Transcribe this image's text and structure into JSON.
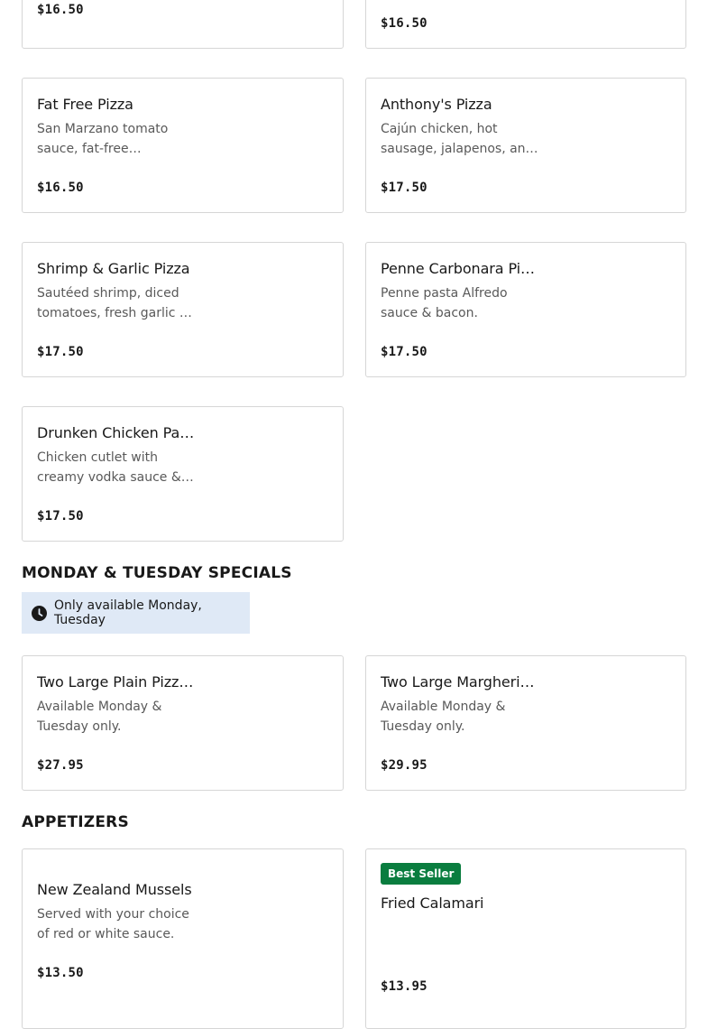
{
  "cards": {
    "top_left": {
      "price": "$16.50"
    },
    "top_right": {
      "price": "$16.50"
    },
    "fat_free": {
      "title": "Fat Free Pizza",
      "desc": "San Marzano tomato sauce, fat-free mozzarella cheese.",
      "price": "$16.50"
    },
    "anthonys": {
      "title": "Anthony's Pizza",
      "desc": "Cajún chicken, hot sausage, jalapenos, and peppers.",
      "price": "$17.50"
    },
    "shrimp_garlic": {
      "title": "Shrimp & Garlic Pizza",
      "desc": "Sautéed shrimp, diced tomatoes, fresh garlic w/ olive oil.",
      "price": "$17.50"
    },
    "penne_carbonara": {
      "title": "Penne Carbonara Pizza",
      "desc": "Penne pasta Alfredo sauce & bacon.",
      "price": "$17.50"
    },
    "drunken_chicken": {
      "title": "Drunken Chicken Parm Pizza",
      "desc": "Chicken cutlet with creamy vodka sauce & mozzarella cheese.",
      "price": "$17.50"
    }
  },
  "specials": {
    "heading": "MONDAY & TUESDAY SPECIALS",
    "availability": "Only available Monday, Tuesday",
    "two_plain": {
      "title": "Two Large Plain Pizzas",
      "desc": "Available Monday & Tuesday only.",
      "price": "$27.95"
    },
    "two_margherita": {
      "title": "Two Large Margherita Pizzas",
      "desc": "Available Monday & Tuesday only.",
      "price": "$29.95"
    }
  },
  "appetizers": {
    "heading": "APPETIZERS",
    "mussels": {
      "title": "New Zealand Mussels",
      "desc": "Served with your choice of red or white sauce.",
      "price": "$13.50"
    },
    "calamari": {
      "badge": "Best Seller",
      "title": "Fried Calamari",
      "price": "$13.95"
    }
  },
  "colors": {
    "badge_bg": "#0a7d3f",
    "availability_bg": "#dfe9f6",
    "card_border": "#d6d6d6"
  },
  "icons": {
    "availability": "clock-icon"
  }
}
